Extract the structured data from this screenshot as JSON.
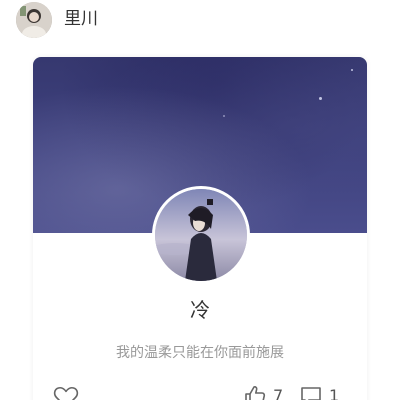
{
  "header": {
    "username": "里川",
    "avatar_icon": "user-avatar"
  },
  "card": {
    "title": "冷",
    "subtitle": "我的温柔只能在你面前施展",
    "cover_colors": [
      "#36386f",
      "#4a4d8c"
    ],
    "actions": {
      "favorite_icon": "heart-outline-icon",
      "like_icon": "thumbs-up-icon",
      "like_count": "7",
      "comment_icon": "comment-icon",
      "comment_count": "1"
    }
  }
}
